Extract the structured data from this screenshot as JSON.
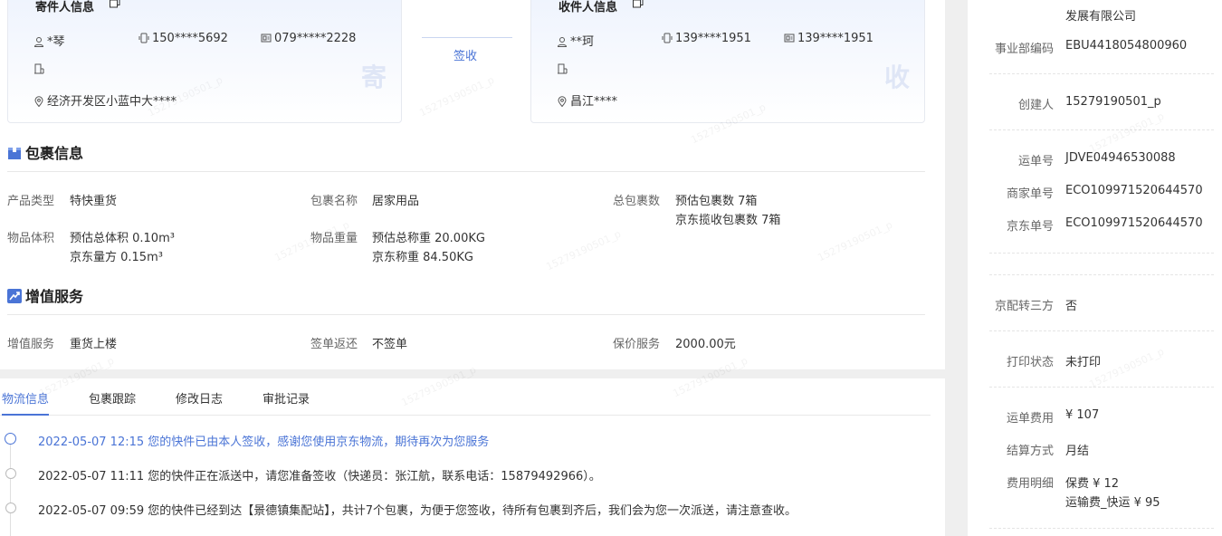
{
  "sender": {
    "title": "寄件人信息",
    "name": "*琴",
    "mobile": "150****5692",
    "phone": "079*****2228",
    "address": "经济开发区小蓝中大****",
    "badge_char": "寄"
  },
  "receiver": {
    "title": "收件人信息",
    "name": "**珂",
    "mobile": "139****1951",
    "phone": "139****1951",
    "address": "昌江****",
    "badge_char": "收"
  },
  "sign_status": "签收",
  "package": {
    "title": "包裹信息",
    "fields": [
      {
        "label": "产品类型",
        "values": [
          "特快重货"
        ]
      },
      {
        "label": "包裹名称",
        "values": [
          "居家用品"
        ]
      },
      {
        "label": "总包裹数",
        "values": [
          "预估包裹数 7箱",
          "京东揽收包裹数 7箱"
        ]
      },
      {
        "label": "物品体积",
        "values": [
          "预估总体积 0.10m³",
          "京东量方 0.15m³"
        ]
      },
      {
        "label": "物品重量",
        "values": [
          "预估总称重 20.00KG",
          "京东称重 84.50KG"
        ]
      }
    ]
  },
  "value_added": {
    "title": "增值服务",
    "fields": [
      {
        "label": "增值服务",
        "value": "重货上楼"
      },
      {
        "label": "签单返还",
        "value": "不签单"
      },
      {
        "label": "保价服务",
        "value": "2000.00元"
      }
    ]
  },
  "tabs": [
    "物流信息",
    "包裹跟踪",
    "修改日志",
    "审批记录"
  ],
  "timeline": [
    {
      "text": "2022-05-07 12:15 您的快件已由本人签收，感谢您使用京东物流，期待再次为您服务"
    },
    {
      "text": "2022-05-07 11:11 您的快件正在派送中，请您准备签收（快递员：张江航，联系电话：15879492966）。"
    },
    {
      "text": "2022-05-07 09:59 您的快件已经到达【景德镇集配站】，共计7个包裹，为便于您签收，待所有包裹到齐后，我们会为您一次派送，请注意查收。"
    }
  ],
  "sidebar": {
    "company_tail": "发展有限公司",
    "rows": [
      {
        "label": "事业部编码",
        "value": "EBU4418054800960"
      },
      {
        "label": "创建人",
        "value": "15279190501_p"
      },
      {
        "label": "运单号",
        "value": "JDVE04946530088"
      },
      {
        "label": "商家单号",
        "value": "ECO109971520644570"
      },
      {
        "label": "京东单号",
        "value": "ECO109971520644570"
      },
      {
        "label": "京配转三方",
        "value": "否"
      },
      {
        "label": "打印状态",
        "value": "未打印"
      },
      {
        "label": "运单费用",
        "value": "¥ 107"
      },
      {
        "label": "结算方式",
        "value": "月结"
      },
      {
        "label": "费用明细",
        "value": "保费 ¥ 12"
      },
      {
        "label": "",
        "value": "运输费_快运 ¥ 95"
      }
    ]
  },
  "watermark": "15279190501_p"
}
